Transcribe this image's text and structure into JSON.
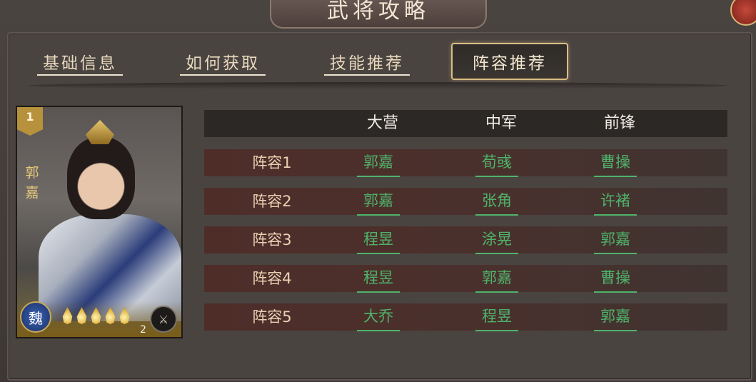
{
  "title": "武将攻略",
  "tabs": [
    {
      "label": "基础信息",
      "active": false
    },
    {
      "label": "如何获取",
      "active": false
    },
    {
      "label": "技能推荐",
      "active": false
    },
    {
      "label": "阵容推荐",
      "active": true
    }
  ],
  "card": {
    "rank": "1",
    "name_chars": [
      "郭",
      "嘉"
    ],
    "faction": "魏",
    "stars": 5,
    "level": "2"
  },
  "table": {
    "headers": [
      "大营",
      "中军",
      "前锋"
    ],
    "rows": [
      {
        "label": "阵容1",
        "heroes": [
          "郭嘉",
          "荀彧",
          "曹操"
        ]
      },
      {
        "label": "阵容2",
        "heroes": [
          "郭嘉",
          "张角",
          "许褚"
        ]
      },
      {
        "label": "阵容3",
        "heroes": [
          "程昱",
          "涂晃",
          "郭嘉"
        ]
      },
      {
        "label": "阵容4",
        "heroes": [
          "程昱",
          "郭嘉",
          "曹操"
        ]
      },
      {
        "label": "阵容5",
        "heroes": [
          "大乔",
          "程昱",
          "郭嘉"
        ]
      }
    ]
  },
  "colors": {
    "hero_link": "#4fb36a",
    "tab_active_border": "#d9bd83"
  }
}
